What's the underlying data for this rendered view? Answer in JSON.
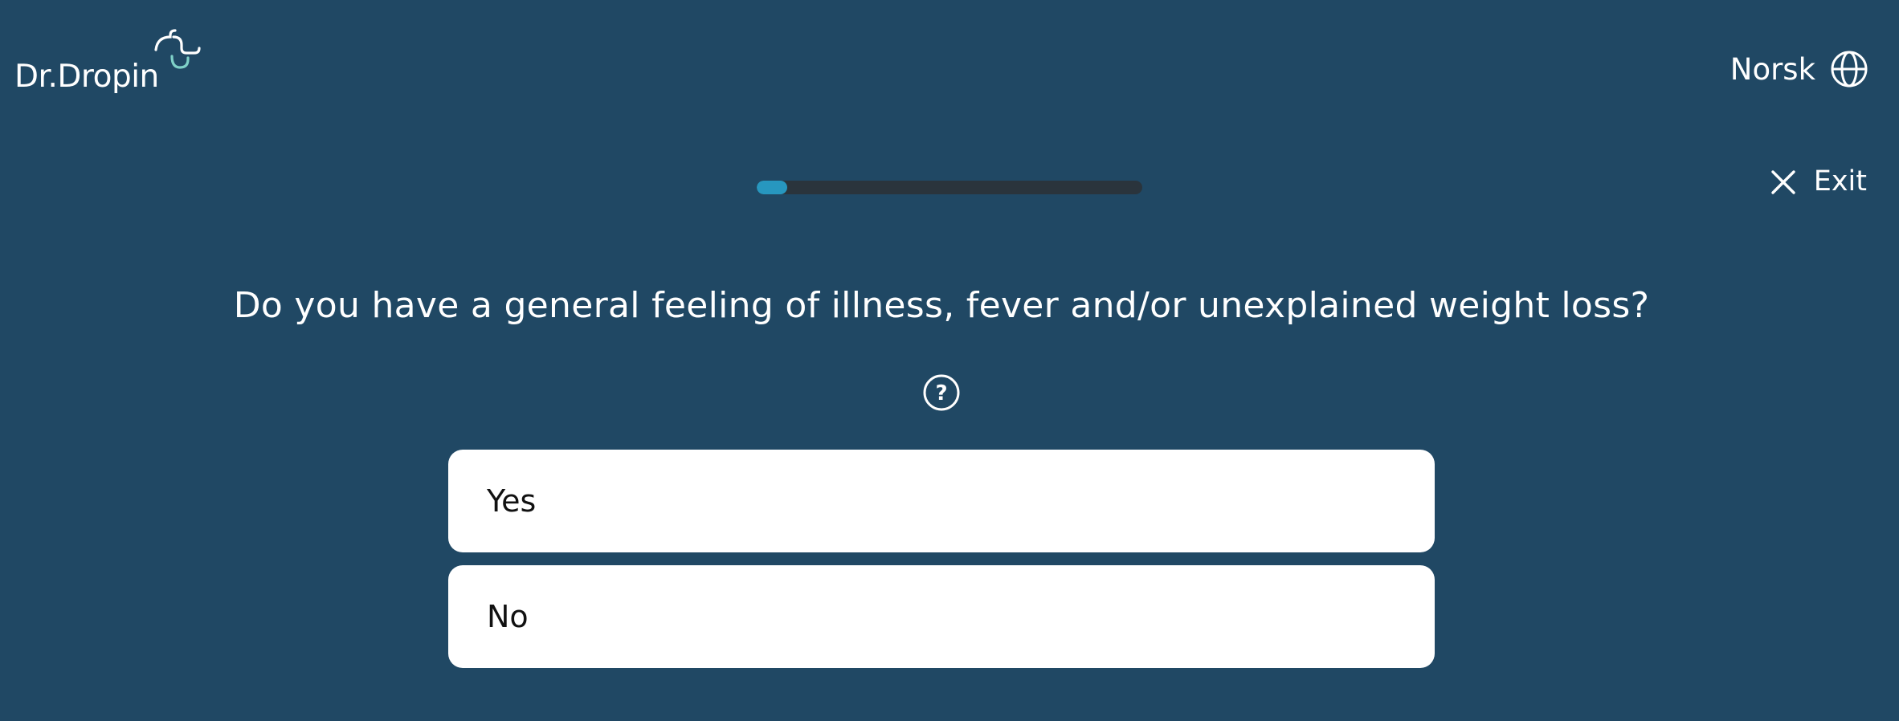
{
  "header": {
    "logo_text": "Dr.Dropin",
    "language_label": "Norsk",
    "language_icon": "globe-icon"
  },
  "progress": {
    "fraction": 0.08,
    "color": "#2797bf",
    "track_color": "#2a343c"
  },
  "exit": {
    "label": "Exit",
    "icon": "close-icon"
  },
  "question": {
    "text": "Do you have a general feeling of illness, fever and/or unexplained weight loss?",
    "help_icon": "help-icon"
  },
  "options": [
    {
      "label": "Yes"
    },
    {
      "label": "No"
    }
  ],
  "colors": {
    "background": "#204864",
    "accent": "#7fd1c8"
  }
}
